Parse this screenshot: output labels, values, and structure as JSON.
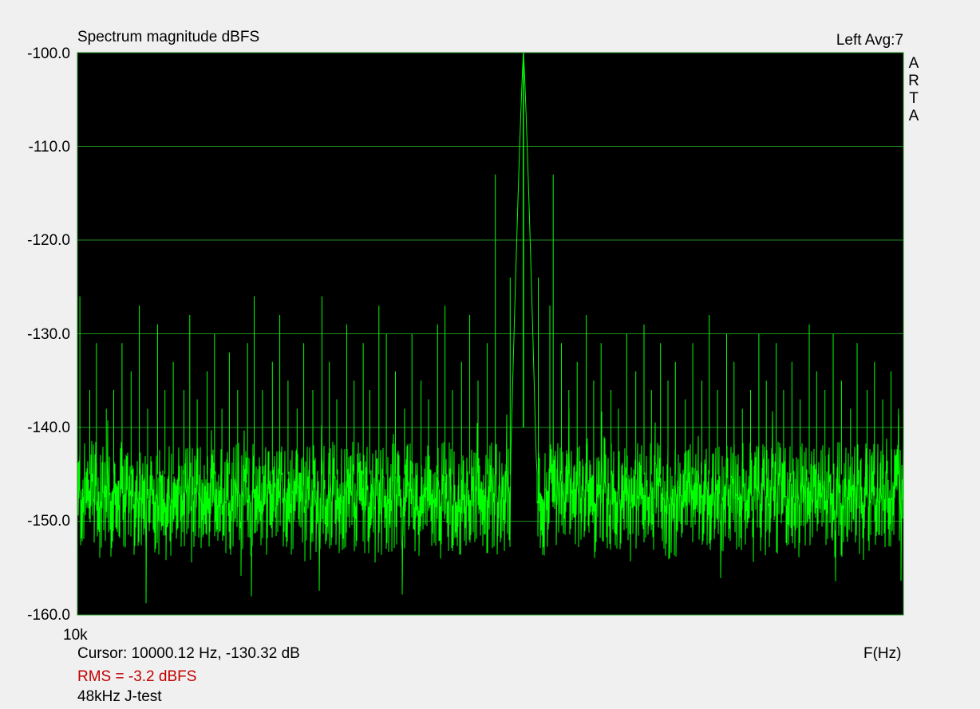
{
  "header": {
    "title": "Spectrum magnitude dBFS",
    "channel_avg": "Left  Avg:7",
    "brand_vertical": [
      "A",
      "R",
      "T",
      "A"
    ]
  },
  "footer": {
    "cursor": "Cursor: 10000.12 Hz, -130.32 dB",
    "xaxis_unit": "F(Hz)",
    "rms": "RMS =   -3.2 dBFS",
    "note": "48kHz J-test"
  },
  "colors": {
    "background": "#f0f0f0",
    "plot_bg": "#000000",
    "grid": "#1f8f1f",
    "trace": "#00ff00",
    "rms_text": "#c00000"
  },
  "chart_data": {
    "type": "line",
    "title": "Spectrum magnitude dBFS",
    "xlabel": "F(Hz)",
    "ylabel": "",
    "ylim": [
      -160,
      -100
    ],
    "yticks": [
      "-100.0",
      "-110.0",
      "-120.0",
      "-130.0",
      "-140.0",
      "-150.0",
      "-160.0"
    ],
    "xticks": [
      "10k"
    ],
    "grid": true,
    "xlim_relative": [
      0,
      100
    ],
    "noise_floor_db": -145,
    "noise_spread_db": 3.5,
    "main_peak": {
      "x": 54,
      "db": -100,
      "bandwidth": 1.2
    },
    "series": [
      {
        "values_description": "spur",
        "spurs": [
          {
            "x": 0.3,
            "db": -126
          },
          {
            "x": 1.5,
            "db": -136
          },
          {
            "x": 2.3,
            "db": -131
          },
          {
            "x": 3.5,
            "db": -138
          },
          {
            "x": 4.4,
            "db": -136
          },
          {
            "x": 5.4,
            "db": -131
          },
          {
            "x": 6.5,
            "db": -134
          },
          {
            "x": 7.5,
            "db": -127
          },
          {
            "x": 8.5,
            "db": -138
          },
          {
            "x": 9.7,
            "db": -129
          },
          {
            "x": 10.6,
            "db": -136
          },
          {
            "x": 11.6,
            "db": -133
          },
          {
            "x": 12.9,
            "db": -136
          },
          {
            "x": 13.6,
            "db": -128
          },
          {
            "x": 14.5,
            "db": -137
          },
          {
            "x": 15.7,
            "db": -134
          },
          {
            "x": 16.6,
            "db": -130
          },
          {
            "x": 17.5,
            "db": -138
          },
          {
            "x": 18.4,
            "db": -132
          },
          {
            "x": 19.4,
            "db": -136
          },
          {
            "x": 20.6,
            "db": -131
          },
          {
            "x": 21.4,
            "db": -126
          },
          {
            "x": 22.4,
            "db": -136
          },
          {
            "x": 23.6,
            "db": -133
          },
          {
            "x": 24.5,
            "db": -128
          },
          {
            "x": 25.5,
            "db": -135
          },
          {
            "x": 26.6,
            "db": -138
          },
          {
            "x": 27.4,
            "db": -131
          },
          {
            "x": 28.5,
            "db": -136
          },
          {
            "x": 29.6,
            "db": -126
          },
          {
            "x": 30.5,
            "db": -133
          },
          {
            "x": 31.4,
            "db": -137
          },
          {
            "x": 32.6,
            "db": -129
          },
          {
            "x": 33.5,
            "db": -135
          },
          {
            "x": 34.6,
            "db": -131
          },
          {
            "x": 35.4,
            "db": -136
          },
          {
            "x": 36.5,
            "db": -127
          },
          {
            "x": 37.4,
            "db": -130
          },
          {
            "x": 38.5,
            "db": -134
          },
          {
            "x": 39.6,
            "db": -138
          },
          {
            "x": 40.5,
            "db": -130
          },
          {
            "x": 41.6,
            "db": -135
          },
          {
            "x": 42.5,
            "db": -137
          },
          {
            "x": 43.6,
            "db": -129
          },
          {
            "x": 44.5,
            "db": -127
          },
          {
            "x": 45.4,
            "db": -136
          },
          {
            "x": 46.5,
            "db": -133
          },
          {
            "x": 47.5,
            "db": -128
          },
          {
            "x": 48.5,
            "db": -135
          },
          {
            "x": 49.6,
            "db": -131
          },
          {
            "x": 50.6,
            "db": -113
          },
          {
            "x": 52.4,
            "db": -124
          },
          {
            "x": 55.8,
            "db": -124
          },
          {
            "x": 57.2,
            "db": -127
          },
          {
            "x": 57.6,
            "db": -113
          },
          {
            "x": 58.6,
            "db": -131
          },
          {
            "x": 59.5,
            "db": -136
          },
          {
            "x": 60.5,
            "db": -133
          },
          {
            "x": 61.6,
            "db": -128
          },
          {
            "x": 62.5,
            "db": -135
          },
          {
            "x": 63.4,
            "db": -131
          },
          {
            "x": 64.6,
            "db": -136
          },
          {
            "x": 65.5,
            "db": -138
          },
          {
            "x": 66.5,
            "db": -130
          },
          {
            "x": 67.6,
            "db": -134
          },
          {
            "x": 68.6,
            "db": -129
          },
          {
            "x": 69.5,
            "db": -136
          },
          {
            "x": 70.6,
            "db": -131
          },
          {
            "x": 71.5,
            "db": -135
          },
          {
            "x": 72.4,
            "db": -133
          },
          {
            "x": 73.6,
            "db": -137
          },
          {
            "x": 74.5,
            "db": -131
          },
          {
            "x": 75.6,
            "db": -135
          },
          {
            "x": 76.5,
            "db": -128
          },
          {
            "x": 77.5,
            "db": -136
          },
          {
            "x": 78.6,
            "db": -130
          },
          {
            "x": 79.5,
            "db": -133
          },
          {
            "x": 80.5,
            "db": -138
          },
          {
            "x": 81.5,
            "db": -136
          },
          {
            "x": 82.5,
            "db": -130
          },
          {
            "x": 83.4,
            "db": -135
          },
          {
            "x": 84.6,
            "db": -131
          },
          {
            "x": 85.5,
            "db": -136
          },
          {
            "x": 86.5,
            "db": -133
          },
          {
            "x": 87.5,
            "db": -137
          },
          {
            "x": 88.6,
            "db": -129
          },
          {
            "x": 89.5,
            "db": -134
          },
          {
            "x": 90.5,
            "db": -136
          },
          {
            "x": 91.5,
            "db": -130
          },
          {
            "x": 92.5,
            "db": -135
          },
          {
            "x": 93.6,
            "db": -138
          },
          {
            "x": 94.4,
            "db": -131
          },
          {
            "x": 95.6,
            "db": -136
          },
          {
            "x": 96.5,
            "db": -133
          },
          {
            "x": 97.5,
            "db": -137
          },
          {
            "x": 98.5,
            "db": -134
          },
          {
            "x": 99.4,
            "db": -138
          }
        ]
      }
    ]
  }
}
